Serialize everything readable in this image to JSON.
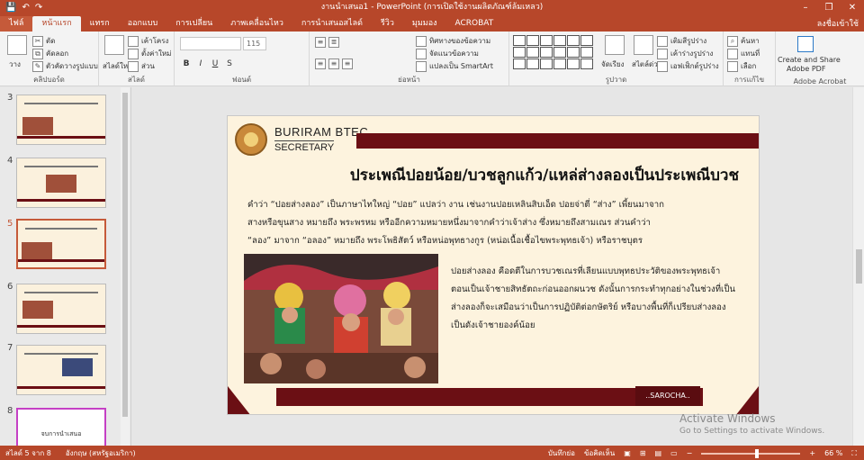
{
  "window": {
    "title": "งานนำเสนอ1 - PowerPoint (การเปิดใช้งานผลิตภัณฑ์ล้มเหลว)",
    "minimize": "–",
    "restore": "❐",
    "close": "✕"
  },
  "qat": {
    "save": "💾",
    "undo": "↶",
    "redo": "↷"
  },
  "tabs": [
    {
      "label": "ไฟล์"
    },
    {
      "label": "หน้าแรก"
    },
    {
      "label": "แทรก"
    },
    {
      "label": "ออกแบบ"
    },
    {
      "label": "การเปลี่ยน"
    },
    {
      "label": "ภาพเคลื่อนไหว"
    },
    {
      "label": "การนำเสนอสไลด์"
    },
    {
      "label": "รีวิว"
    },
    {
      "label": "มุมมอง"
    },
    {
      "label": "ACROBAT"
    }
  ],
  "signin": "ลงชื่อเข้าใช้",
  "ribbon": {
    "clipboard": {
      "paste": "วาง",
      "cut": "ตัด",
      "copy": "คัดลอก",
      "format_painter": "ตัวคัดวางรูปแบบ",
      "label": "คลิปบอร์ด"
    },
    "slides": {
      "new_slide": "สไลด์ใหม่",
      "layout": "เค้าโครง",
      "reset": "ตั้งค่าใหม่",
      "section": "ส่วน",
      "label": "สไลด์"
    },
    "font": {
      "size": "115",
      "bold": "B",
      "italic": "I",
      "underline": "U",
      "strike": "S",
      "label": "ฟอนต์"
    },
    "paragraph": {
      "text_direction": "ทิศทางของข้อความ",
      "align_text": "จัดแนวข้อความ",
      "smartart": "แปลงเป็น SmartArt",
      "label": "ย่อหน้า"
    },
    "drawing": {
      "arrange": "จัดเรียง",
      "quick_styles": "สไตล์ด่วน",
      "fill": "เติมสีรูปร่าง",
      "outline": "เค้าร่างรูปร่าง",
      "effects": "เอฟเฟ็กต์รูปร่าง",
      "label": "รูปวาด"
    },
    "editing": {
      "find": "ค้นหา",
      "replace": "แทนที่",
      "select": "เลือก",
      "label": "การแก้ไข"
    },
    "adobe": {
      "create": "Create and Share",
      "create2": "Adobe PDF",
      "label": "Adobe Acrobat"
    }
  },
  "thumbnails": [
    {
      "num": "3"
    },
    {
      "num": "4"
    },
    {
      "num": "5"
    },
    {
      "num": "6"
    },
    {
      "num": "7"
    },
    {
      "num": "8",
      "text": "จบการนำเสนอ"
    }
  ],
  "slide": {
    "brand_line1": "BURIRAM BTEC.",
    "brand_line2": "SECRETARY",
    "title": "ประเพณีปอยน้อย/บวชลูกแก้ว/แหล่ส่างลองเป็นประเพณีบวช",
    "para1": [
      "คำว่า “ปอยส่างลอง”  เป็นภาษาไทใหญ่ “ปอย”  แปลว่า งาน เช่นงานปอยเหลินสิบเอ็ด ปอยจ่าตี่ “ส่าง”  เพี้ยนมาจาก",
      "สางหรือขุนสาง หมายถึง พระพรหม หรืออีกความหมายหนึ่งมาจากคำว่าเจ้าส่าง ซึ่งหมายถึงสามเณร ส่วนคำว่า",
      "“ลอง” มาจาก “อลอง” หมายถึง พระโพธิสัตว์ หรือหน่อพุทธางกูร (หน่อเนื้อเชื้อไขพระพุทธเจ้า) หรือราชบุตร"
    ],
    "para2": [
      "ปอยส่างลอง คือดตีในการบวชเณรที่เลียนแบบพุทธประวัติของพระพุทธเจ้า",
      "ตอนเป็นเจ้าชายสิทธัตถะก่อนออกผนวช ดังนั้นการกระทำทุกอย่างในช่วงที่เป็น",
      "ส่างลองก็จะเสมือนว่าเป็นการปฏิบัติต่อกษัตริย์ หรือบางพื้นที่ก็เปรียบส่างลอง",
      "เป็นดังเจ้าชายองค์น้อย"
    ],
    "credit": "..SAROCHA.."
  },
  "watermark": {
    "line1": "Activate Windows",
    "line2": "Go to Settings to activate Windows."
  },
  "status": {
    "slide": "สไลด์ 5 จาก 8",
    "language": "อังกฤษ (สหรัฐอเมริกา)",
    "notes": "บันทึกย่อ",
    "comments": "ข้อคิดเห็น",
    "zoom": "66 %",
    "zoom_level": 0.66
  },
  "colors": {
    "accent": "#b7472a",
    "maroon": "#6b0f14",
    "slide_bg": "#fdf3de"
  }
}
